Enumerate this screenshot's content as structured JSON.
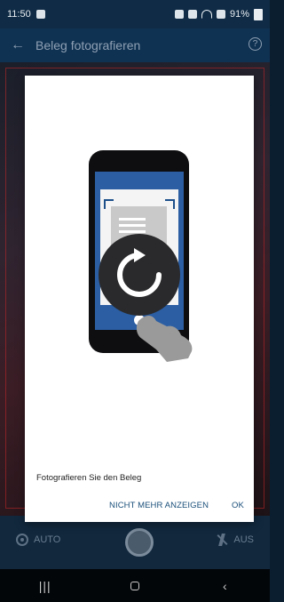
{
  "status_bar": {
    "time": "11:50",
    "battery": "91%"
  },
  "app_bar": {
    "back_icon": "arrow-left-icon",
    "title": "Beleg fotografieren",
    "help_icon": "question-icon"
  },
  "dialog": {
    "message": "Fotografieren Sie den Beleg",
    "actions": {
      "dont_show": "NICHT MEHR ANZEIGEN",
      "ok": "OK"
    }
  },
  "camera_controls": {
    "left_label": "AUTO",
    "right_label": "AUS"
  },
  "colors": {
    "accent": "#1a4f7a",
    "phone_screen_blue": "#2b5ea3"
  }
}
